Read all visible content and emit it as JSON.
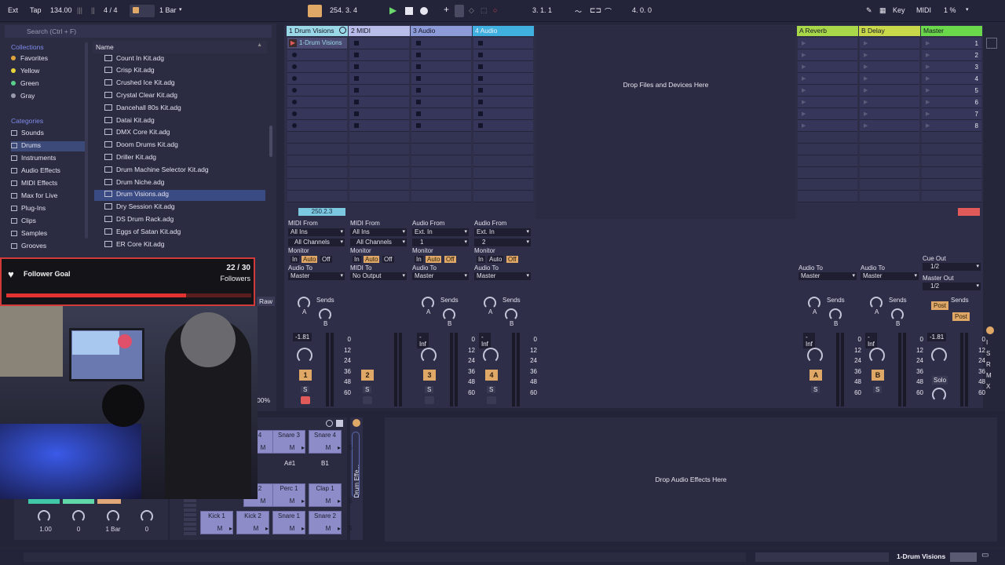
{
  "topbar": {
    "ext": "Ext",
    "tap": "Tap",
    "tempo": "134.00",
    "time_sig": "4 / 4",
    "quantize": "1 Bar",
    "position": "254.  3.  4",
    "loop_start": "3.  1.  1",
    "loop_length": "4.  0.  0",
    "key_label": "Key",
    "midi_label": "MIDI",
    "cpu": "1 %"
  },
  "browser": {
    "search_placeholder": "Search (Ctrl + F)",
    "collections_header": "Collections",
    "collections": [
      {
        "label": "Favorites",
        "color": "#e0a33a"
      },
      {
        "label": "Yellow",
        "color": "#e8d23a"
      },
      {
        "label": "Green",
        "color": "#5ad08a"
      },
      {
        "label": "Gray",
        "color": "#9a9aac"
      }
    ],
    "categories_header": "Categories",
    "categories": [
      {
        "label": "Sounds",
        "selected": false
      },
      {
        "label": "Drums",
        "selected": true
      },
      {
        "label": "Instruments",
        "selected": false
      },
      {
        "label": "Audio Effects",
        "selected": false
      },
      {
        "label": "MIDI Effects",
        "selected": false
      },
      {
        "label": "Max for Live",
        "selected": false
      },
      {
        "label": "Plug-Ins",
        "selected": false
      },
      {
        "label": "Clips",
        "selected": false
      },
      {
        "label": "Samples",
        "selected": false
      },
      {
        "label": "Grooves",
        "selected": false
      }
    ],
    "name_header": "Name",
    "files": [
      "Count In Kit.adg",
      "Crisp Kit.adg",
      "Crushed Ice Kit.adg",
      "Crystal Clear Kit.adg",
      "Dancehall 80s Kit.adg",
      "Datai Kit.adg",
      "DMX Core Kit.adg",
      "Doom Drums Kit.adg",
      "Driller Kit.adg",
      "Drum Machine Selector Kit.adg",
      "Drum Niche.adg",
      "Drum Visions.adg",
      "Dry Session Kit.adg",
      "DS Drum Rack.adg",
      "Eggs of Satan Kit.adg",
      "ER Core Kit.adg"
    ],
    "selected_file_index": 11,
    "raw_label": "Raw"
  },
  "session": {
    "tracks": [
      {
        "name": "1 Drum Visions",
        "color": "#9ad8e8",
        "type": "midi",
        "clip": "1-Drum Visions",
        "num": "1",
        "io_from_label": "MIDI From",
        "io_from": "All Ins",
        "io_sub": "All Channels",
        "io_to_label": "Audio To",
        "io_to": "Master",
        "volume": "-1.81"
      },
      {
        "name": "2 MIDI",
        "color": "#b8bce8",
        "type": "midi",
        "clip": "",
        "num": "2",
        "io_from_label": "MIDI From",
        "io_from": "All Ins",
        "io_sub": "All Channels",
        "io_to_label": "MIDI To",
        "io_to": "No Output",
        "volume": ""
      },
      {
        "name": "3 Audio",
        "color": "#8c9ad8",
        "type": "audio",
        "clip": "",
        "num": "3",
        "io_from_label": "Audio From",
        "io_from": "Ext. In",
        "io_sub": "1",
        "io_to_label": "Audio To",
        "io_to": "Master",
        "volume": "-Inf"
      },
      {
        "name": "4 Audio",
        "color": "#40b0e0",
        "type": "audio",
        "clip": "",
        "num": "4",
        "io_from_label": "Audio From",
        "io_from": "Ext. In",
        "io_sub": "2",
        "io_to_label": "Audio To",
        "io_to": "Master",
        "volume": "-Inf"
      }
    ],
    "returns": [
      {
        "name": "A Reverb",
        "color": "#a8d84a",
        "letter": "A",
        "io_to": "Master",
        "volume": "-Inf"
      },
      {
        "name": "B Delay",
        "color": "#c8d84a",
        "letter": "B",
        "io_to": "Master",
        "volume": "-Inf"
      }
    ],
    "master": {
      "name": "Master",
      "color": "#6ad84a",
      "cue_out_label": "Cue Out",
      "cue_out": "1/2",
      "master_out_label": "Master Out",
      "master_out": "1/2",
      "volume": "-1.81",
      "solo": "Solo",
      "post1": "Post",
      "post2": "Post"
    },
    "scenes": [
      "1",
      "2",
      "3",
      "4",
      "5",
      "6",
      "7",
      "8"
    ],
    "drop_files_text": "Drop Files and Devices Here",
    "clip_time": "250.2.3",
    "monitor_label": "Monitor",
    "monitor_in": "In",
    "monitor_auto": "Auto",
    "monitor_off": "Off",
    "sends_label": "Sends",
    "send_a": "A",
    "send_b": "B",
    "scale": [
      "0",
      "12",
      "24",
      "36",
      "48",
      "60"
    ],
    "audio_to_label": "Audio To"
  },
  "drumrack": {
    "title": "Drum Effe...",
    "pads_row1": [
      "4",
      "Snare 3",
      "Snare 4"
    ],
    "notes": [
      "A#1",
      "B1"
    ],
    "pads_row3": [
      "2",
      "Perc 1",
      "Clap 1"
    ],
    "pads_row4": [
      "Kick 1",
      "Kick 2",
      "Snare 1",
      "Snare 2"
    ],
    "macro_values": [
      "1.00",
      "0",
      "1 Bar",
      "0"
    ]
  },
  "effects": {
    "drop_text": "Drop Audio Effects Here"
  },
  "overlay": {
    "goal_title": "Follower Goal",
    "goal_count": "22 / 30",
    "goal_unit": "Followers",
    "goal_progress": 0.733,
    "zoom": "00%"
  },
  "status": {
    "track_name": "1-Drum Visions"
  }
}
